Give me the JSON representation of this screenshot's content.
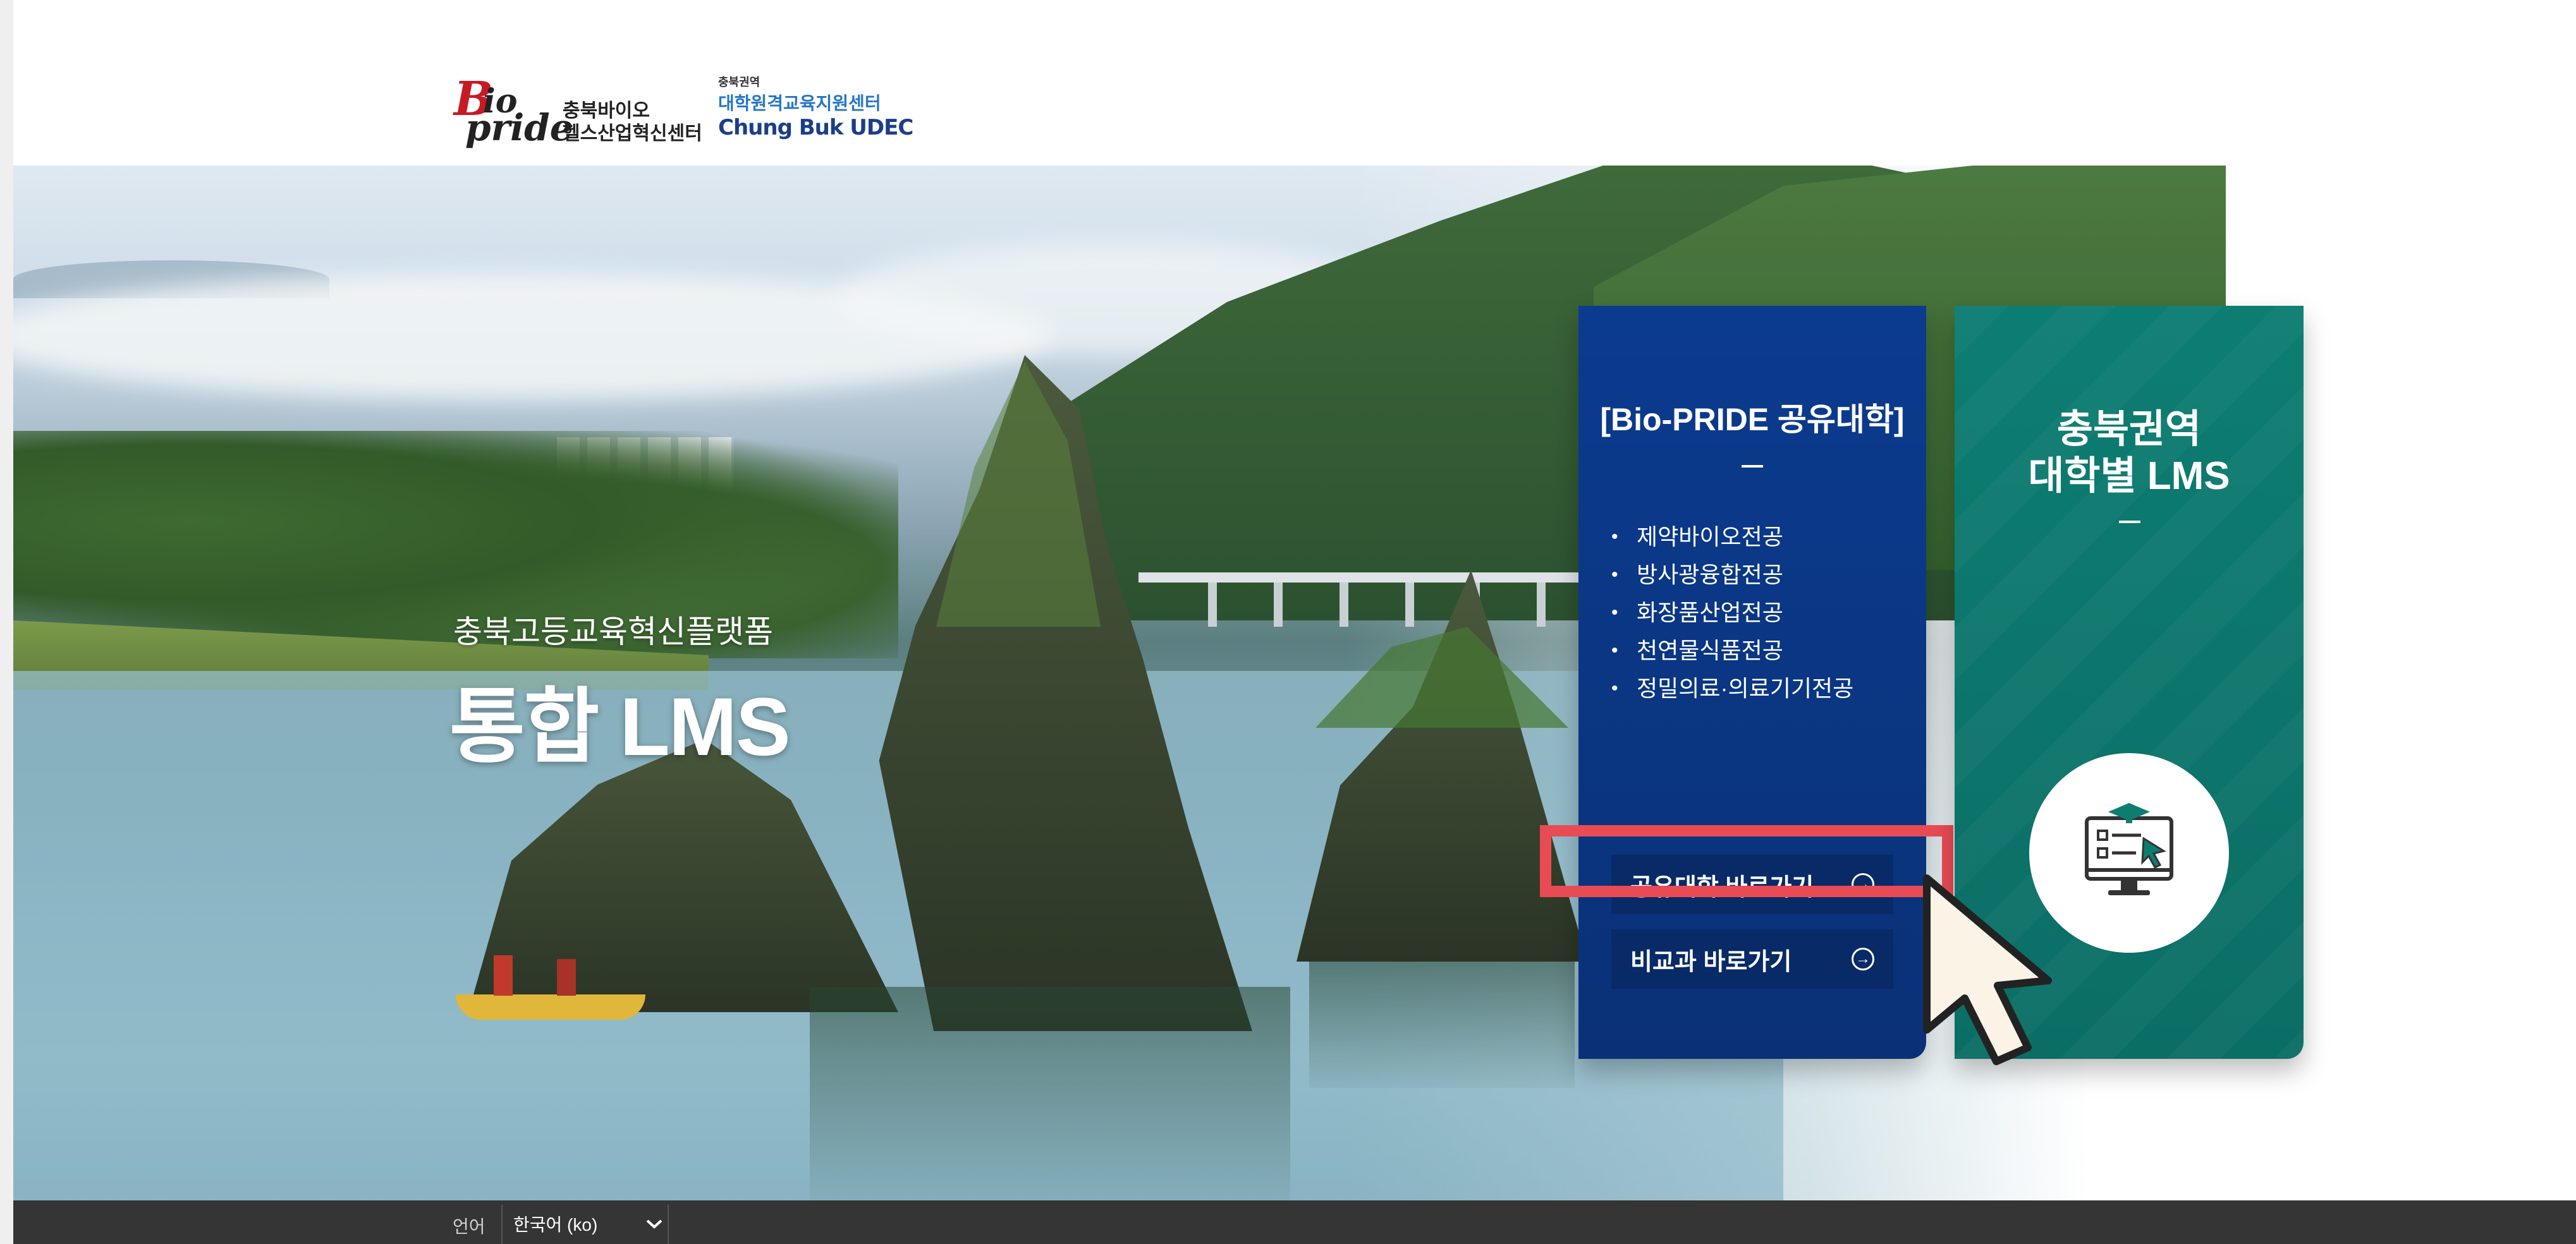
{
  "header": {
    "biopride_logo": {
      "mark": [
        "B",
        "io",
        "pride"
      ],
      "line1": "충북바이오",
      "line2": "헬스산업혁신센터"
    },
    "udec_logo": {
      "line1": "충북권역",
      "line2": "대학원격교육지원센터",
      "line3": "Chung Buk UDEC"
    }
  },
  "hero": {
    "subtitle": "충북고등교육혁신플랫폼",
    "title": "통합 LMS"
  },
  "card_biopride": {
    "title": "[Bio-PRIDE 공유대학]",
    "majors": [
      "제약바이오전공",
      "방사광융합전공",
      "화장품산업전공",
      "천연물식품전공",
      "정밀의료·의료기기전공"
    ],
    "button_shared": "공유대학 바로가기",
    "button_nondegree": "비교과 바로가기",
    "button_icon": "arrow-circle-icon"
  },
  "card_lms": {
    "title_line1": "충북권역",
    "title_line2": "대학별 LMS",
    "icon": "monitor-elearning-icon"
  },
  "footer": {
    "language_label": "언어",
    "language_selected": "한국어 (ko)"
  },
  "colors": {
    "biopride_card": "#0b3b8f",
    "lms_card": "#0d7d72",
    "highlight": "#e94b55",
    "footer": "#353535"
  }
}
